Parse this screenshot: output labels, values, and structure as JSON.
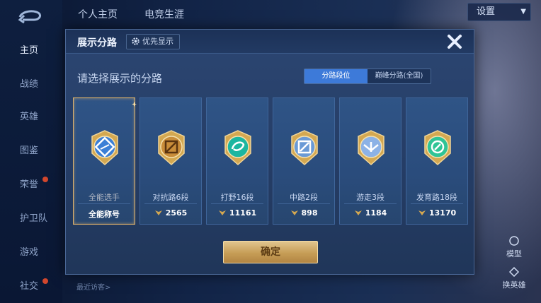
{
  "background": {
    "top_tabs": [
      "个人主页",
      "电竞生涯"
    ],
    "settings_label": "设置",
    "sidebar": [
      {
        "label": "主页",
        "active": true
      },
      {
        "label": "战绩",
        "active": false
      },
      {
        "label": "英雄",
        "active": false
      },
      {
        "label": "图鉴",
        "active": false
      },
      {
        "label": "荣誉",
        "active": false,
        "dot": true
      },
      {
        "label": "护卫队",
        "active": false
      },
      {
        "label": "游戏",
        "active": false
      },
      {
        "label": "社交",
        "active": false,
        "dot": true
      }
    ],
    "right_buttons": [
      "模型",
      "换英雄"
    ],
    "recent_visitors": "最近访客>"
  },
  "modal": {
    "title": "展示分路",
    "priority_label": "优先显示",
    "subtitle": "请选择展示的分路",
    "segments": [
      {
        "label": "分路段位",
        "active": true
      },
      {
        "label": "巅峰分路(全国)",
        "active": false
      }
    ],
    "cards": [
      {
        "name": "全能选手",
        "score": "全能称号",
        "badge": "all-round-badge-icon",
        "selected": true,
        "color": "#3b7fd6"
      },
      {
        "name": "对抗路6段",
        "score": "2565",
        "badge": "clash-lane-badge-icon",
        "selected": false,
        "color": "#c98d3a"
      },
      {
        "name": "打野16段",
        "score": "11161",
        "badge": "jungle-badge-icon",
        "selected": false,
        "color": "#1bb6a0"
      },
      {
        "name": "中路2段",
        "score": "898",
        "badge": "mid-lane-badge-icon",
        "selected": false,
        "color": "#6a9ad6"
      },
      {
        "name": "游走3段",
        "score": "1184",
        "badge": "roam-badge-icon",
        "selected": false,
        "color": "#8cb2e6"
      },
      {
        "name": "发育路18段",
        "score": "13170",
        "badge": "farm-lane-badge-icon",
        "selected": false,
        "color": "#2fc496"
      }
    ],
    "confirm_label": "确定"
  },
  "colors": {
    "accent_blue": "#3d7ad9",
    "gold": "#e2b46b",
    "score_icon": "#d4a851"
  }
}
